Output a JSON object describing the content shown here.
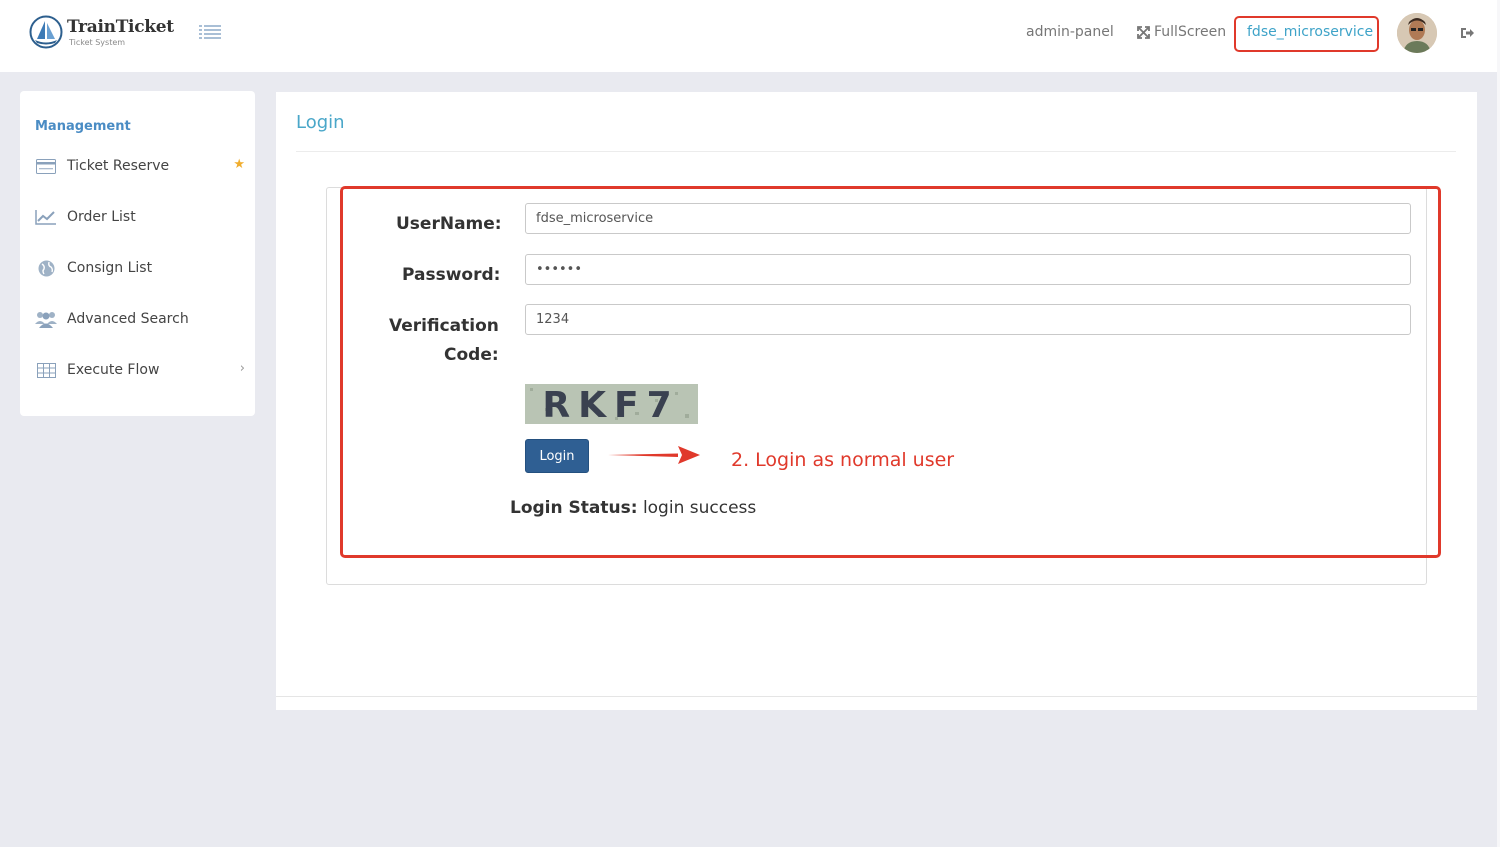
{
  "app": {
    "brand": "TrainTicket",
    "tagline": "Ticket System"
  },
  "header": {
    "admin_panel": "admin-panel",
    "fullscreen": "FullScreen",
    "username": "fdse_microservice"
  },
  "sidebar": {
    "heading": "Management",
    "items": [
      {
        "label": "Ticket Reserve",
        "icon": "credit-card-icon"
      },
      {
        "label": "Order List",
        "icon": "line-chart-icon"
      },
      {
        "label": "Consign List",
        "icon": "globe-icon"
      },
      {
        "label": "Advanced Search",
        "icon": "users-icon"
      },
      {
        "label": "Execute Flow",
        "icon": "table-icon"
      }
    ]
  },
  "login": {
    "title": "Login",
    "username_label": "UserName:",
    "username_value": "fdse_microservice",
    "password_label": "Password:",
    "password_value": "••••••",
    "verification_label_1": "Verification",
    "verification_label_2": "Code:",
    "verification_value": "1234",
    "captcha_text": "RKF7",
    "button_label": "Login",
    "annotation": "2. Login as normal user",
    "status_label": "Login Status:",
    "status_value": "login success"
  },
  "colors": {
    "accent": "#4aa7c9",
    "highlight": "#e0392b",
    "button": "#2f5f93"
  }
}
